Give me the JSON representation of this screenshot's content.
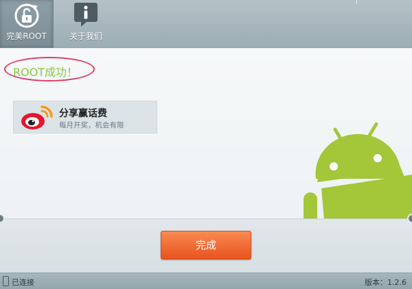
{
  "toolbar": {
    "root_tab_label": "完美ROOT",
    "about_tab_label": "关于我们"
  },
  "main": {
    "success_message": "ROOT成功！",
    "share_card": {
      "title": "分享赢话费",
      "subtitle": "每月开奖，机会有限"
    }
  },
  "actions": {
    "done_label": "完成"
  },
  "statusbar": {
    "connection": "已连接",
    "version": "版本：1.2.6"
  },
  "icons": {
    "root_tab": "unlock-refresh-icon",
    "about_tab": "info-bubble-icon",
    "share": "weibo-icon",
    "mascot": "android-icon",
    "device": "phone-icon"
  },
  "colors": {
    "success_text": "#8cc63e",
    "highlight_oval": "#e23a63",
    "done_button": "#e8531f",
    "android_green": "#a4c639"
  }
}
